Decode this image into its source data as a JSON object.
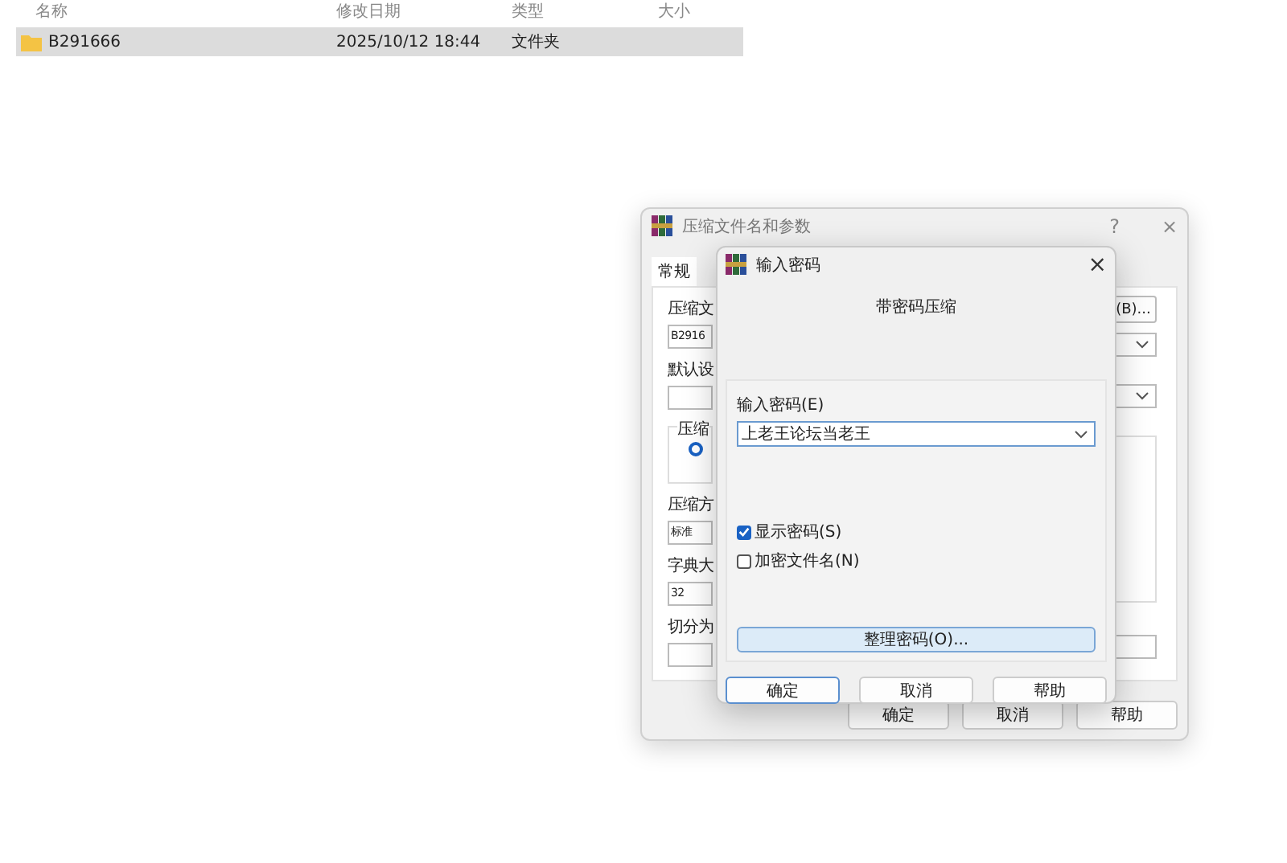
{
  "file_list": {
    "columns": [
      "名称",
      "修改日期",
      "类型",
      "大小"
    ],
    "rows": [
      {
        "name": "B291666",
        "modified": "2025/10/12 18:44",
        "type": "文件夹",
        "selected": true
      }
    ]
  },
  "back_dialog": {
    "title": "压缩文件名和参数",
    "help_button": "?",
    "close_button": "×",
    "tabs": [
      {
        "label": "常规",
        "selected": true
      }
    ],
    "left_fragments": [
      {
        "kind": "label",
        "text": "压缩文"
      },
      {
        "kind": "field",
        "value": "B2916"
      },
      {
        "kind": "label",
        "text": "默认设"
      },
      {
        "kind": "field"
      },
      {
        "kind": "group",
        "label": "压缩",
        "radio_selected": true
      },
      {
        "kind": "label",
        "text": "压缩方"
      },
      {
        "kind": "field",
        "value": "标准"
      },
      {
        "kind": "label",
        "text": "字典大"
      },
      {
        "kind": "field",
        "value": "32"
      },
      {
        "kind": "label",
        "text": "切分为"
      },
      {
        "kind": "field"
      }
    ],
    "right_fragments": [
      {
        "kind": "button",
        "text": "(B)..."
      },
      {
        "kind": "combo"
      },
      {
        "kind": "combo"
      },
      {
        "kind": "group"
      },
      {
        "kind": "field"
      }
    ],
    "buttons": [
      "确定",
      "取消",
      "帮助"
    ]
  },
  "password_dialog": {
    "title": "输入密码",
    "close_button": "×",
    "heading": "带密码压缩",
    "password_label": "输入密码(E)",
    "password_value": "上老王论坛当老王",
    "checkboxes": [
      {
        "label": "显示密码(S)",
        "checked": true
      },
      {
        "label": "加密文件名(N)",
        "checked": false
      }
    ],
    "organize_button": "整理密码(O)...",
    "buttons": [
      {
        "label": "确定",
        "default": true
      },
      {
        "label": "取消",
        "default": false
      },
      {
        "label": "帮助",
        "default": false
      }
    ]
  }
}
